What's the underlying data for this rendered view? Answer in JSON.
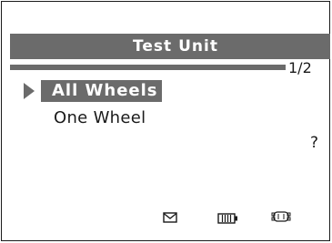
{
  "header": {
    "title": "Test Unit"
  },
  "pagination": {
    "indicator": "1/2",
    "current": 1,
    "total": 2
  },
  "menu": {
    "items": [
      {
        "label": "All Wheels",
        "selected": true
      },
      {
        "label": "One Wheel",
        "selected": false
      }
    ]
  },
  "help": {
    "symbol": "?"
  },
  "status_bar": {
    "icons": [
      "message-icon",
      "battery-icon",
      "vehicle-connection-icon"
    ]
  },
  "colors": {
    "highlight": "#6b6b6b",
    "text": "#1a1a1a",
    "background": "#ffffff"
  }
}
